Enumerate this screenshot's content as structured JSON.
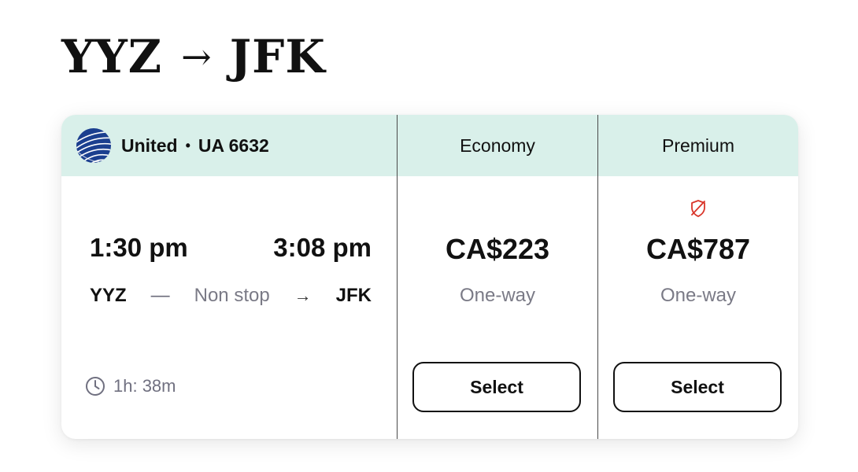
{
  "route": {
    "origin": "YYZ",
    "arrow": "→",
    "destination": "JFK"
  },
  "flight": {
    "airline": "United",
    "separator": "•",
    "flight_number": "UA 6632",
    "logo_icon": "united-globe-icon",
    "depart_time": "1:30 pm",
    "arrive_time": "3:08 pm",
    "origin_code": "YYZ",
    "dash": "—",
    "stops": "Non stop",
    "arrow": "→",
    "destination_code": "JFK",
    "duration_icon": "clock-icon",
    "duration": "1h: 38m"
  },
  "fares": [
    {
      "class": "Economy",
      "price": "CA$223",
      "trip_type": "One-way",
      "button_label": "Select"
    },
    {
      "class": "Premium",
      "price": "CA$787",
      "trip_type": "One-way",
      "button_label": "Select",
      "badge_icon": "no-protection-shield-icon"
    }
  ],
  "colors": {
    "header_bg": "#d9f0ea",
    "badge_red": "#d9352a",
    "logo_blue": "#1b3f8f"
  }
}
